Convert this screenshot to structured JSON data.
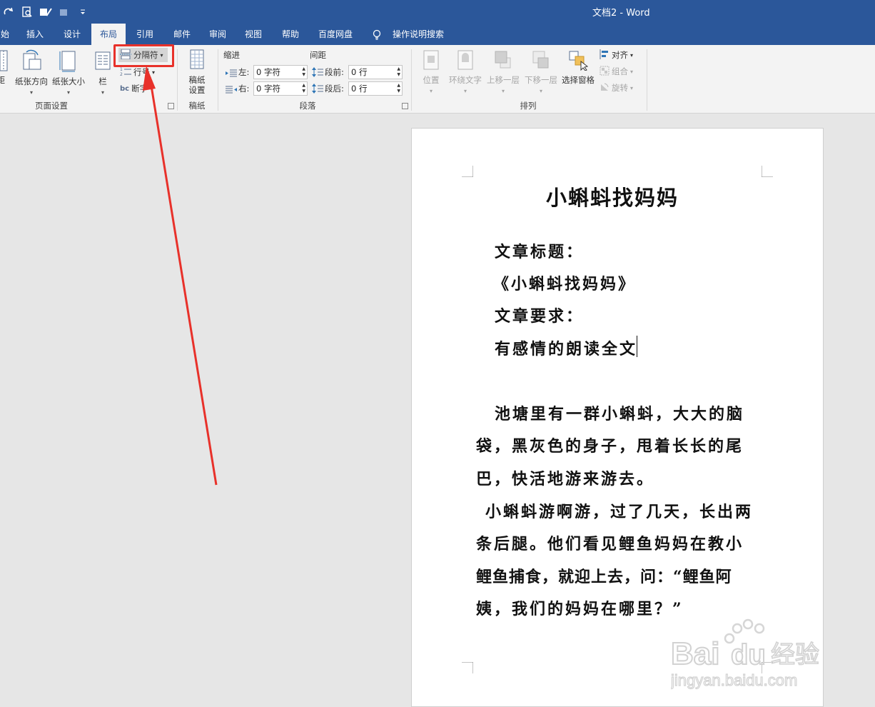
{
  "window": {
    "doc_title": "文档2 - Word"
  },
  "tabs": [
    {
      "label": "始"
    },
    {
      "label": "插入"
    },
    {
      "label": "设计"
    },
    {
      "label": "布局",
      "active": true
    },
    {
      "label": "引用"
    },
    {
      "label": "邮件"
    },
    {
      "label": "审阅"
    },
    {
      "label": "视图"
    },
    {
      "label": "帮助"
    },
    {
      "label": "百度网盘"
    },
    {
      "label": "操作说明搜索"
    }
  ],
  "ribbon": {
    "page_setup": {
      "label": "页面设置",
      "margins": "边距",
      "orientation": "纸张方向",
      "size": "纸张大小",
      "columns": "栏",
      "breaks": "分隔符",
      "line_numbers": "行号",
      "hyphenation": "断字"
    },
    "manuscript": {
      "label": "稿纸",
      "button_line1": "稿纸",
      "button_line2": "设置"
    },
    "paragraph": {
      "label": "段落",
      "indent_title": "缩进",
      "spacing_title": "间距",
      "left_label": "左:",
      "left_value": "0 字符",
      "right_label": "右:",
      "right_value": "0 字符",
      "before_label": "段前:",
      "before_value": "0 行",
      "after_label": "段后:",
      "after_value": "0 行"
    },
    "arrange": {
      "label": "排列",
      "position": "位置",
      "wrap_text": "环绕文字",
      "bring_forward": "上移一层",
      "send_backward": "下移一层",
      "selection_pane": "选择窗格",
      "align": "对齐",
      "group": "组合",
      "rotate": "旋转"
    }
  },
  "document": {
    "title": "小蝌蚪找妈妈",
    "lines": [
      "文章标题：",
      "《小蝌蚪找妈妈》",
      "文章要求：",
      "有感情的朗读全文",
      "池塘里有一群小蝌蚪，大大的脑",
      "袋，黑灰色的身子，甩着长长的尾",
      "巴，快活地游来游去。",
      "小蝌蚪游啊游，过了几天，长出两",
      "条后腿。他们看见鲤鱼妈妈在教小",
      "鲤鱼捕食，就迎上去，问：“鲤鱼阿",
      "姨，我们的妈妈在哪里？”"
    ]
  },
  "watermark": {
    "brand": "Baidu经验",
    "url": "jingyan.baidu.com"
  },
  "colors": {
    "ribbon_blue": "#2b579a",
    "annotation_red": "#e8312a"
  }
}
